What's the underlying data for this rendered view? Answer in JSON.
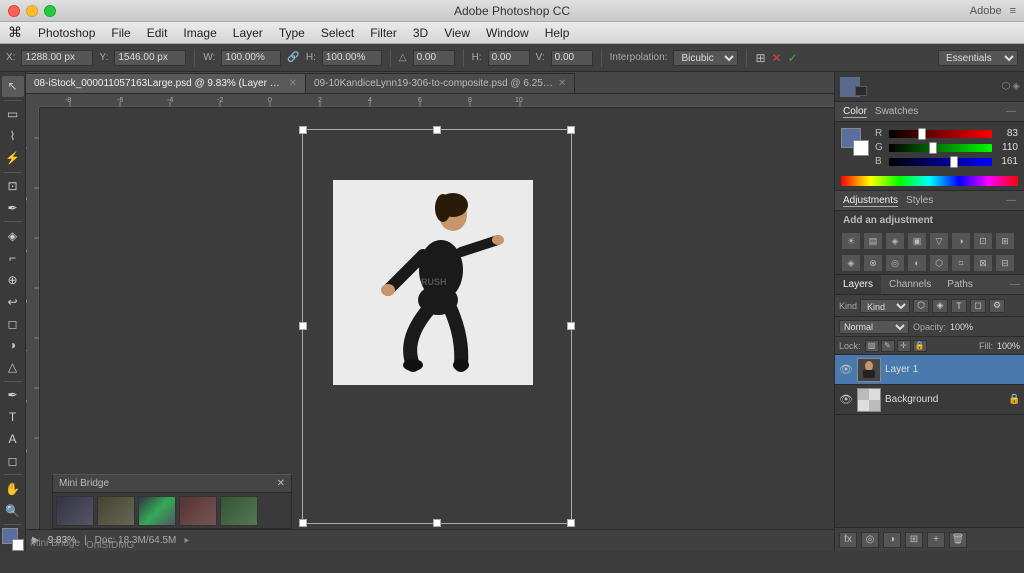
{
  "titlebar": {
    "title": "Adobe Photoshop CC",
    "right_icons": [
      "Adobe",
      "≡"
    ]
  },
  "menubar": {
    "apple": "⌘",
    "items": [
      "Photoshop",
      "File",
      "Edit",
      "Image",
      "Layer",
      "Type",
      "Select",
      "Filter",
      "3D",
      "View",
      "Window",
      "Help"
    ]
  },
  "optionsbar": {
    "x_label": "X:",
    "x_value": "1288.00 px",
    "y_label": "Y:",
    "y_value": "1546.00 px",
    "w_label": "W:",
    "w_value": "100.00%",
    "h_label": "H:",
    "h_value": "100.00%",
    "rot_label": "△",
    "rot_value": "0.00",
    "h2_label": "H:",
    "h2_value": "0.00",
    "v_label": "V:",
    "v_value": "0.00",
    "interp_label": "Interpolation:",
    "interp_value": "Bicubic",
    "essentials": "Essentials"
  },
  "tabs": [
    {
      "label": "08-iStock_000011057163Large.psd @ 9.83% (Layer 1, RGB/8*)",
      "active": true
    },
    {
      "label": "09-10KandiceLynn19-306-to-composite.psd @ 6.25% (RGB/16*)",
      "active": false
    }
  ],
  "status": {
    "zoom": "9.83%",
    "size": "Doc: 18.3M/64.5M",
    "label": "Mini Bridge",
    "watermark": "OniSfDMG"
  },
  "color_panel": {
    "tabs": [
      "Color",
      "Swatches"
    ],
    "r_label": "R",
    "r_value": "83",
    "g_label": "G",
    "g_value": "110",
    "b_label": "B",
    "b_value": "161",
    "r_pct": 32,
    "g_pct": 43,
    "b_pct": 63
  },
  "adjustments": {
    "title": "Adjustments",
    "styles_tab": "Styles",
    "subtitle": "Add an adjustment",
    "icons": [
      "☀",
      "⚙",
      "◈",
      "▣",
      "▽",
      "◑",
      "⊡",
      "⊞",
      "◈",
      "⊗",
      "◎",
      "◐",
      "⬡",
      "⌗",
      "⊠",
      "⊟",
      "⊡",
      "▥",
      "⊻",
      "⊽"
    ]
  },
  "layers": {
    "tabs": [
      "Layers",
      "Channels",
      "Paths"
    ],
    "kind_label": "Kind",
    "blend_mode": "Normal",
    "opacity_label": "Opacity:",
    "opacity_value": "100%",
    "lock_label": "Lock:",
    "fill_label": "Fill:",
    "fill_value": "100%",
    "items": [
      {
        "name": "Layer 1",
        "visible": true,
        "active": true
      },
      {
        "name": "Background",
        "visible": true,
        "active": false,
        "locked": true
      }
    ],
    "footer_icons": [
      "fx",
      "+",
      "◎",
      "⊞",
      "✕"
    ]
  },
  "tools": [
    "↖",
    "M",
    "L",
    "W",
    "✂",
    "⊕",
    "◻",
    "⌨",
    "✒",
    "◈",
    "G",
    "B",
    "S",
    "△",
    "A",
    "⌥",
    "⚡",
    "✎",
    "🔍",
    "✋",
    "R",
    "Z",
    "◈",
    "⧉"
  ]
}
